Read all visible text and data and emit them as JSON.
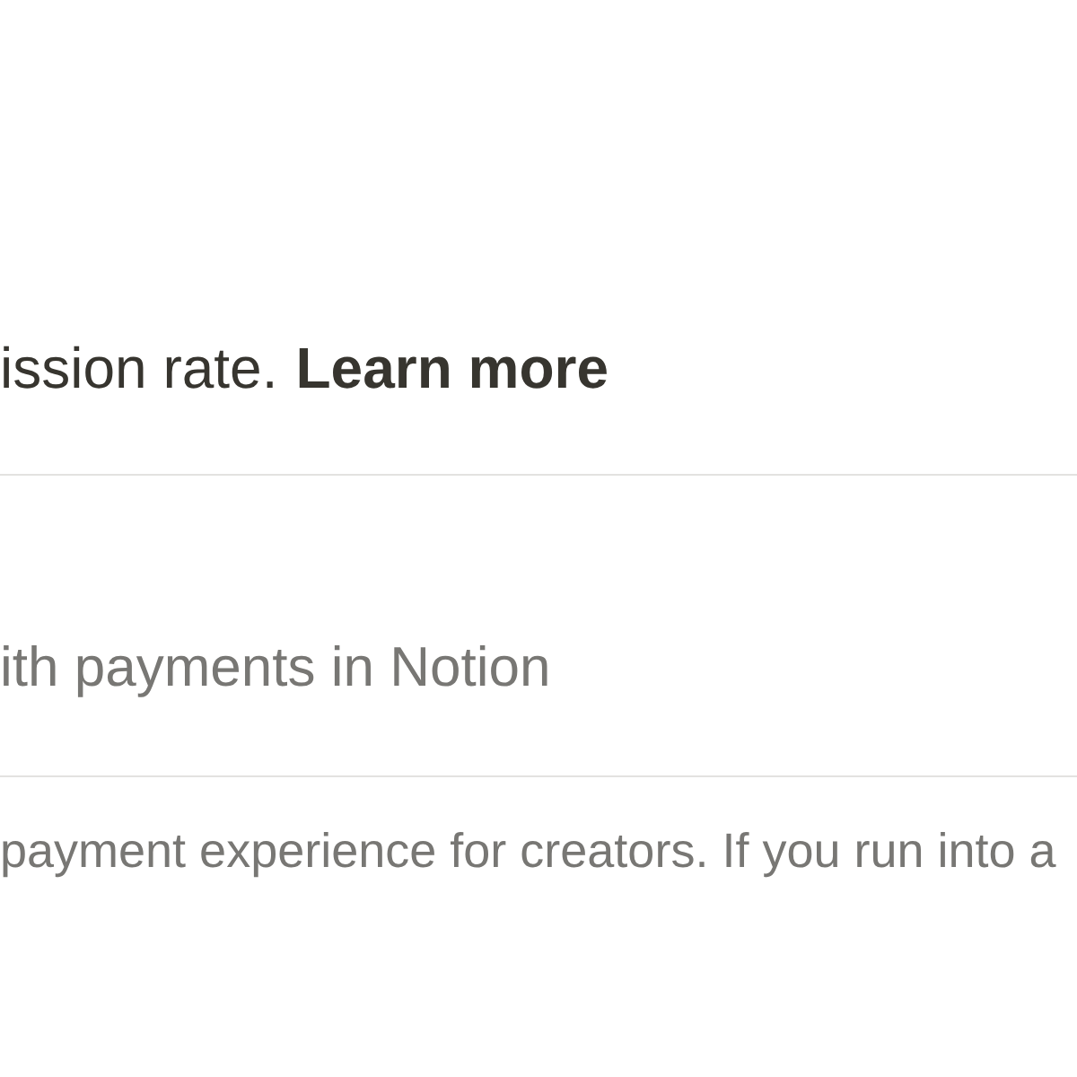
{
  "sections": [
    {
      "kind": "note",
      "text": "ission rate.",
      "link": "Learn more"
    },
    {
      "kind": "heading",
      "text": "ith payments in Notion"
    },
    {
      "kind": "body",
      "text": "payment experience for creators. If you run into a"
    }
  ]
}
